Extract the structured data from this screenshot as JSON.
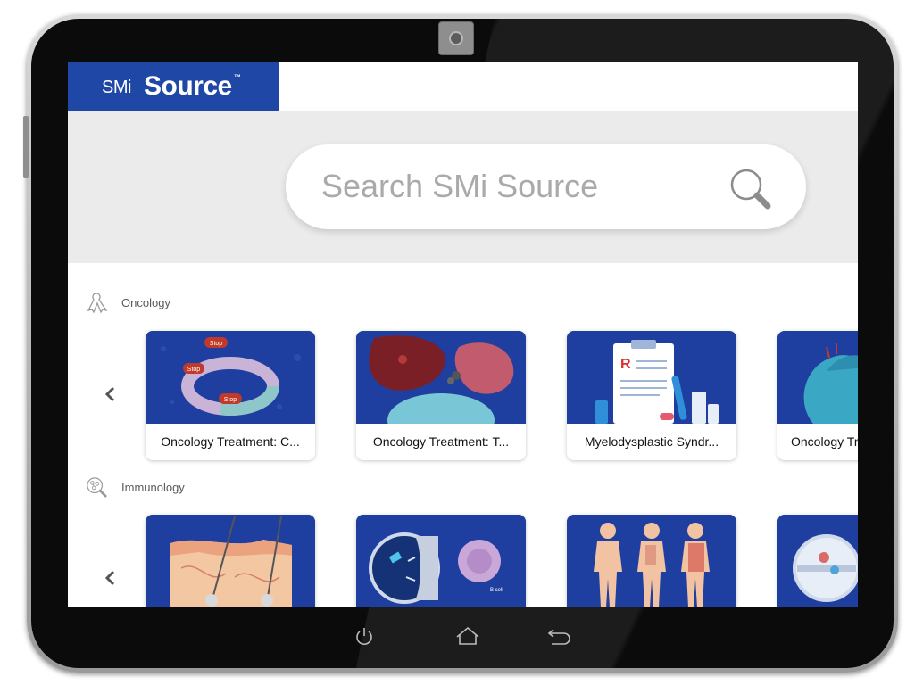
{
  "app": {
    "logo_prefix": "SMi",
    "logo_main": "Source",
    "logo_tm": "™"
  },
  "search": {
    "placeholder": "Search SMi Source"
  },
  "sections": [
    {
      "label": "Oncology",
      "icon": "ribbon-icon",
      "cards": [
        {
          "title": "Oncology Treatment: C..."
        },
        {
          "title": "Oncology Treatment: T..."
        },
        {
          "title": "Myelodysplastic Syndr..."
        },
        {
          "title": "Oncology Tr"
        }
      ]
    },
    {
      "label": "Immunology",
      "icon": "magnifier-molecule-icon",
      "cards": [
        {
          "title": ""
        },
        {
          "title": ""
        },
        {
          "title": ""
        },
        {
          "title": ""
        }
      ]
    }
  ],
  "thumb_labels": {
    "stop": "Stop",
    "bcell": "B cell"
  },
  "colors": {
    "brand_blue": "#1f48a6",
    "thumb_blue": "#1f3fa0",
    "band_gray": "#ebebeb"
  }
}
